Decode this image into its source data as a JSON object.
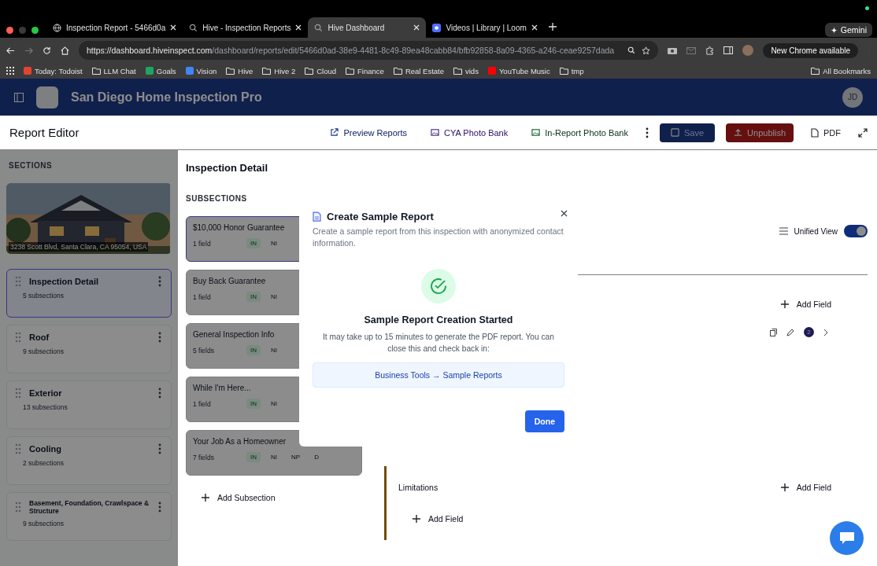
{
  "browser": {
    "tabs": [
      {
        "title": "Inspection Report - 5466d0a",
        "selected": false,
        "kind": "globe"
      },
      {
        "title": "Hive - Inspection Reports",
        "selected": false,
        "kind": "hive"
      },
      {
        "title": "Hive Dashboard",
        "selected": true,
        "kind": "hive"
      },
      {
        "title": "Videos | Library | Loom",
        "selected": false,
        "kind": "loom"
      }
    ],
    "gemini": "Gemini",
    "url": {
      "host": "https://dashboard.hiveinspect.com",
      "path": "/dashboard/reports/edit/5466d0ad-38e9-4481-8c49-89ea48cabb84/bfb92858-8a09-4365-a246-ceae9257dada"
    },
    "update": "New Chrome available",
    "bookmarks": [
      {
        "label": "Today: Todoist",
        "kind": "app",
        "color": "#e44332"
      },
      {
        "label": "LLM Chat",
        "kind": "folder"
      },
      {
        "label": "Goals",
        "kind": "app",
        "color": "#1fa463"
      },
      {
        "label": "Vision",
        "kind": "app",
        "color": "#4285f4"
      },
      {
        "label": "Hive",
        "kind": "folder"
      },
      {
        "label": "Hive 2",
        "kind": "folder"
      },
      {
        "label": "Cloud",
        "kind": "folder"
      },
      {
        "label": "Finance",
        "kind": "folder"
      },
      {
        "label": "Real Estate",
        "kind": "folder"
      },
      {
        "label": "vids",
        "kind": "folder"
      },
      {
        "label": "YouTube Music",
        "kind": "app",
        "color": "#ff0000"
      },
      {
        "label": "tmp",
        "kind": "folder"
      }
    ],
    "all_bookmarks": "All Bookmarks"
  },
  "header": {
    "title": "San Diego Home Inspection Pro",
    "avatar": "JD"
  },
  "toolbar": {
    "title": "Report Editor",
    "actions": [
      {
        "label": "Preview Reports",
        "kind": "link",
        "disabled": false
      },
      {
        "label": "CYA Photo Bank",
        "kind": "purple",
        "disabled": false
      },
      {
        "label": "In-Report Photo Bank",
        "kind": "green",
        "disabled": false
      },
      {
        "kind": "more",
        "disabled": false
      },
      {
        "label": "Save",
        "kind": "primary",
        "disabled": true
      },
      {
        "label": "Unpublish",
        "kind": "danger",
        "disabled": false
      },
      {
        "label": "PDF",
        "kind": "plain",
        "disabled": false
      },
      {
        "kind": "expand",
        "disabled": false
      }
    ]
  },
  "sections": {
    "heading": "SECTIONS",
    "photo_caption": "3238 Scott Blvd, Santa Clara, CA 95054, USA",
    "items": [
      {
        "name": "Inspection Detail",
        "count": "5 subsections",
        "selected": true
      },
      {
        "name": "Roof",
        "count": "9 subsections",
        "selected": false
      },
      {
        "name": "Exterior",
        "count": "13 subsections",
        "selected": false
      },
      {
        "name": "Cooling",
        "count": "2 subsections",
        "selected": false
      },
      {
        "name": "Basement, Foundation, Crawlspace & Structure",
        "count": "9 subsections",
        "selected": false
      }
    ]
  },
  "detail": {
    "title": "Inspection Detail",
    "subsections_heading": "SUBSECTIONS",
    "add_subsection": "Add Subsection",
    "subsections": [
      {
        "name": "$10,000 Honor Guarantee",
        "fields": "1 field",
        "selected": true,
        "badges": [
          {
            "label": "IN",
            "selected": true
          },
          {
            "label": "NI",
            "selected": false
          }
        ]
      },
      {
        "name": "Buy Back Guarantee",
        "fields": "1 field",
        "selected": false,
        "badges": [
          {
            "label": "IN",
            "selected": true
          },
          {
            "label": "NI",
            "selected": false
          }
        ]
      },
      {
        "name": "General Inspection Info",
        "fields": "5 fields",
        "selected": false,
        "badges": [
          {
            "label": "IN",
            "selected": true
          },
          {
            "label": "NI",
            "selected": false
          }
        ]
      },
      {
        "name": "While I'm Here...",
        "fields": "1 field",
        "selected": false,
        "badges": [
          {
            "label": "IN",
            "selected": true
          },
          {
            "label": "NI",
            "selected": false
          }
        ]
      },
      {
        "name": "Your Job As a Homeowner",
        "fields": "7 fields",
        "selected": false,
        "badges": [
          {
            "label": "IN",
            "selected": true
          },
          {
            "label": "NI",
            "selected": false
          },
          {
            "label": "NP",
            "selected": false
          },
          {
            "label": "D",
            "selected": false
          }
        ]
      }
    ]
  },
  "editor": {
    "view_label": "Unified View",
    "unified_view": true,
    "add_field": "Add Field",
    "comment_count": "2",
    "limitations": "Limitations",
    "limitations_add_field": "Add Field",
    "bottom_add_field": "Add Field"
  },
  "modal": {
    "title": "Create Sample Report",
    "description": "Create a sample report from this inspection with anonymized contact information.",
    "status_title": "Sample Report Creation Started",
    "status_text": "It may take up to 15 minutes to generate the PDF report. You can close this and check back in:",
    "path": "Business Tools → Sample Reports",
    "done": "Done"
  }
}
